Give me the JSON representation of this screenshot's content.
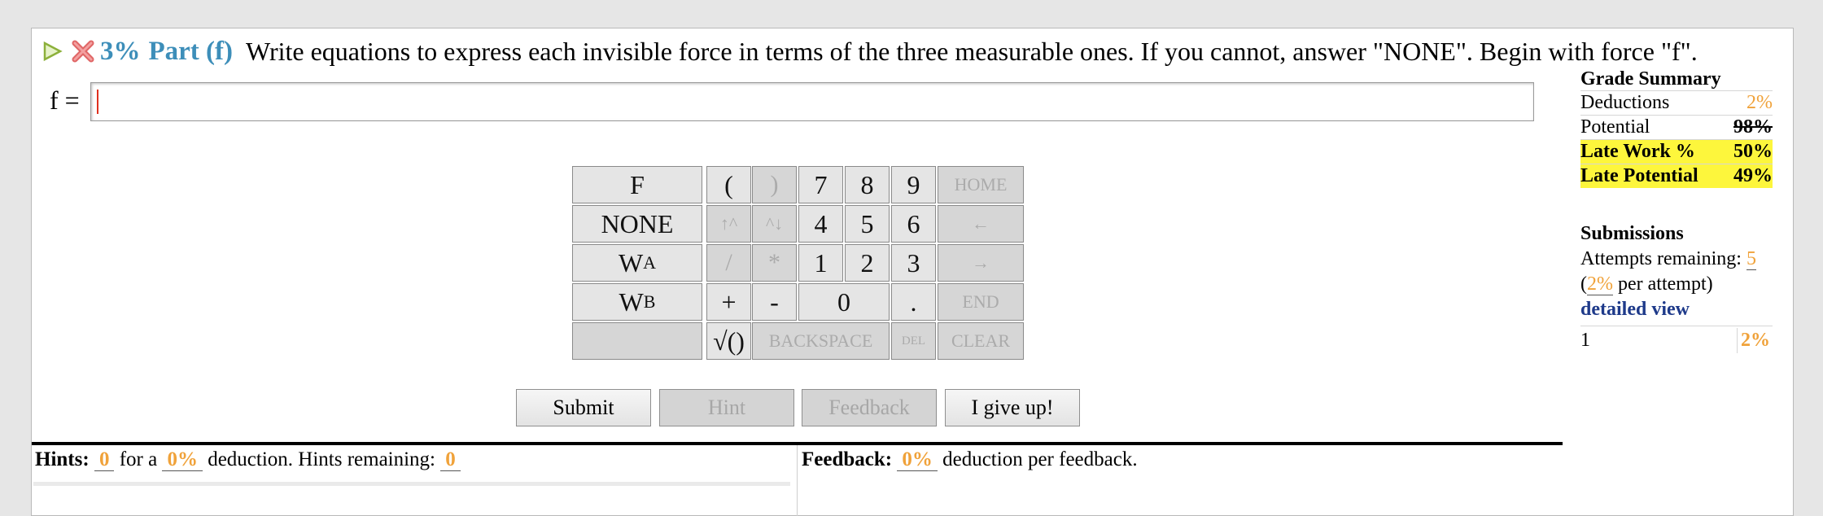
{
  "header": {
    "percent": "3%",
    "part": "Part (f)",
    "instructions": "Write equations to express each invisible force in terms of the three measurable ones. If you cannot, answer \"NONE\". Begin with force \"f\"."
  },
  "answer": {
    "label": "f =",
    "value": ""
  },
  "keypad": {
    "vars": [
      "F",
      "NONE",
      "W",
      "W"
    ],
    "subs": [
      "A",
      "B"
    ],
    "open_paren": "(",
    "close_paren": ")",
    "digits": [
      "7",
      "8",
      "9",
      "4",
      "5",
      "6",
      "1",
      "2",
      "3",
      "0",
      "."
    ],
    "up": "↑^",
    "down": "^↓",
    "div": "/",
    "mul": "*",
    "plus": "+",
    "minus": "-",
    "sqrt": "√()",
    "home": "HOME",
    "left": "←",
    "right": "→",
    "end": "END",
    "backspace": "BACKSPACE",
    "del": "DEL",
    "clear": "CLEAR"
  },
  "buttons": {
    "submit": "Submit",
    "hint": "Hint",
    "feedback": "Feedback",
    "giveup": "I give up!"
  },
  "hints": {
    "label": "Hints:",
    "count": "0",
    "for_a": "for a",
    "deduction": "0%",
    "deduction_text": "deduction. Hints remaining:",
    "remaining": "0"
  },
  "feedback": {
    "label": "Feedback:",
    "deduction": "0%",
    "text": "deduction per feedback."
  },
  "grade_summary": {
    "title": "Grade Summary",
    "deductions_label": "Deductions",
    "deductions": "2%",
    "potential_label": "Potential",
    "potential": "98%",
    "late_work_label": "Late Work %",
    "late_work": "50%",
    "late_potential_label": "Late Potential",
    "late_potential": "49%"
  },
  "submissions": {
    "title": "Submissions",
    "attempts_label": "Attempts remaining:",
    "attempts": "5",
    "per_attempt": "2%",
    "per_attempt_text": "per attempt)",
    "detailed_view": "detailed view",
    "attempt_number": "1",
    "attempt_deduction": "2%"
  },
  "colors": {
    "accent_blue": "#3d8eb9",
    "orange": "#f0a23a",
    "highlight": "#fdf63c",
    "link": "#1e3a8a"
  },
  "icons": {
    "play": "play-icon",
    "incorrect": "x-icon"
  }
}
